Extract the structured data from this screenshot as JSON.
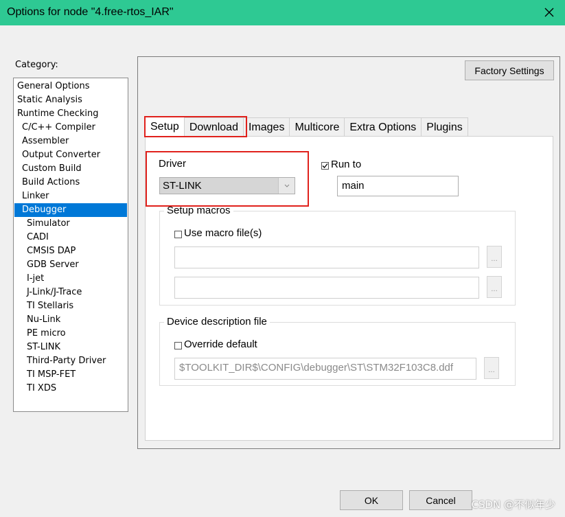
{
  "window": {
    "title": "Options for node \"4.free-rtos_IAR\"",
    "titlebar_color": "#2ec993"
  },
  "category": {
    "label": "Category:",
    "items": [
      {
        "label": "General Options",
        "level": 0
      },
      {
        "label": "Static Analysis",
        "level": 0
      },
      {
        "label": "Runtime Checking",
        "level": 0
      },
      {
        "label": "C/C++ Compiler",
        "level": 1
      },
      {
        "label": "Assembler",
        "level": 1
      },
      {
        "label": "Output Converter",
        "level": 1
      },
      {
        "label": "Custom Build",
        "level": 1
      },
      {
        "label": "Build Actions",
        "level": 1
      },
      {
        "label": "Linker",
        "level": 1
      },
      {
        "label": "Debugger",
        "level": 1,
        "selected": true
      },
      {
        "label": "Simulator",
        "level": 2
      },
      {
        "label": "CADI",
        "level": 2
      },
      {
        "label": "CMSIS DAP",
        "level": 2
      },
      {
        "label": "GDB Server",
        "level": 2
      },
      {
        "label": "I-jet",
        "level": 2
      },
      {
        "label": "J-Link/J-Trace",
        "level": 2
      },
      {
        "label": "TI Stellaris",
        "level": 2
      },
      {
        "label": "Nu-Link",
        "level": 2
      },
      {
        "label": "PE micro",
        "level": 2
      },
      {
        "label": "ST-LINK",
        "level": 2
      },
      {
        "label": "Third-Party Driver",
        "level": 2
      },
      {
        "label": "TI MSP-FET",
        "level": 2
      },
      {
        "label": "TI XDS",
        "level": 2
      }
    ],
    "selected_color": "#0078d7"
  },
  "factory_settings_label": "Factory Settings",
  "tabs": [
    {
      "label": "Setup",
      "active": true
    },
    {
      "label": "Download"
    },
    {
      "label": "Images"
    },
    {
      "label": "Multicore"
    },
    {
      "label": "Extra Options"
    },
    {
      "label": "Plugins"
    }
  ],
  "setup": {
    "driver_label": "Driver",
    "driver_value": "ST-LINK",
    "run_to_label": "Run to",
    "run_to_checked": true,
    "run_to_value": "main",
    "setup_macros_title": "Setup macros",
    "use_macro_label": "Use macro file(s)",
    "use_macro_checked": false,
    "macro_file_1": "",
    "macro_file_2": "",
    "browse_label": "...",
    "device_desc_title": "Device description file",
    "override_label": "Override default",
    "override_checked": false,
    "device_desc_path": "$TOOLKIT_DIR$\\CONFIG\\debugger\\ST\\STM32F103C8.ddf"
  },
  "buttons": {
    "ok": "OK",
    "cancel": "Cancel"
  },
  "watermark": "CSDN @不似年少",
  "highlight_color": "#e0201b"
}
